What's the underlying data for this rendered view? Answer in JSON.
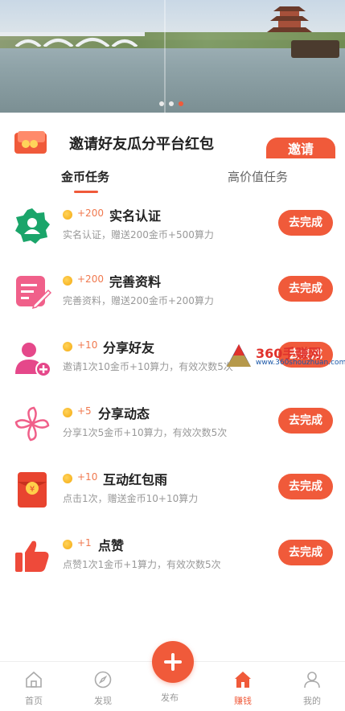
{
  "banner": {
    "dots": 3,
    "active_dot": 2
  },
  "invite": {
    "text": "邀请好友瓜分平台红包",
    "button": "邀请"
  },
  "tabs": {
    "active": "金币任务",
    "other": "高价值任务"
  },
  "tasks": [
    {
      "reward": "+200",
      "title": "实名认证",
      "desc": "实名认证，赠送200金币+500算力",
      "button": "去完成"
    },
    {
      "reward": "+200",
      "title": "完善资料",
      "desc": "完善资料，赠送200金币+200算力",
      "button": "去完成"
    },
    {
      "reward": "+10",
      "title": "分享好友",
      "desc": "邀请1次10金币+10算力，有效次数5次",
      "button": "去完成"
    },
    {
      "reward": "+5",
      "title": "分享动态",
      "desc": "分享1次5金币+10算力，有效次数5次",
      "button": "去完成"
    },
    {
      "reward": "+10",
      "title": "互动红包雨",
      "desc": "点击1次，赠送金币10+10算力",
      "button": "去完成"
    },
    {
      "reward": "+1",
      "title": "点赞",
      "desc": "点赞1次1金币+1算力，有效次数5次",
      "button": "去完成"
    }
  ],
  "watermark": {
    "title": "360手赚网",
    "url": "www.360shouzhuan.com"
  },
  "nav": {
    "items": [
      {
        "label": "首页",
        "icon": "home-outline-icon"
      },
      {
        "label": "发现",
        "icon": "compass-icon"
      },
      {
        "label": "发布",
        "icon": "plus-icon"
      },
      {
        "label": "赚钱",
        "icon": "home-filled-icon"
      },
      {
        "label": "我的",
        "icon": "user-icon"
      }
    ],
    "active": "赚钱"
  },
  "colors": {
    "accent": "#f05a3a",
    "green": "#1aa56a",
    "pink": "#f0608a"
  }
}
